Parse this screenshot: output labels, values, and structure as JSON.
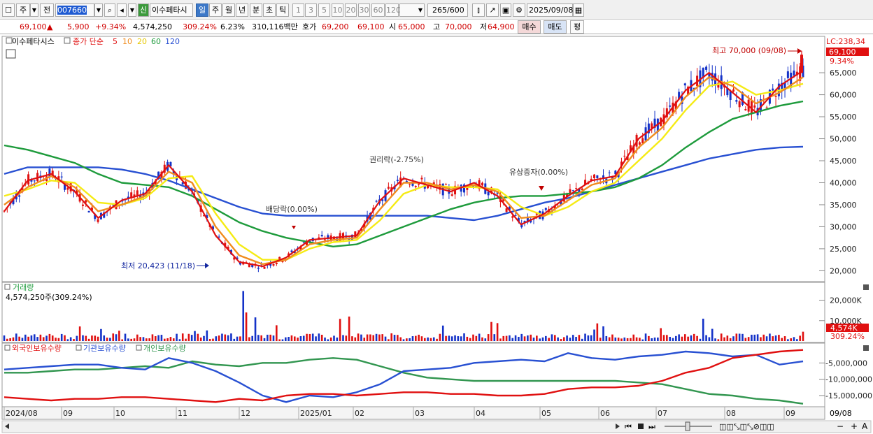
{
  "toolbar": {
    "period_type": "주",
    "prefix": "전",
    "stock_code": "007660",
    "stock_tag": "신",
    "stock_name": "이수페타시",
    "timeframes": [
      "일",
      "주",
      "월",
      "년",
      "분",
      "초",
      "틱"
    ],
    "active_timeframe": "일",
    "intervals": [
      "1",
      "3",
      "5",
      "10",
      "20",
      "30",
      "60",
      "120"
    ],
    "bar_count": "265",
    "bar_total": "/600",
    "date": "2025/09/08"
  },
  "quote": {
    "price": "69,100",
    "change_arrow": "▲",
    "change": "5,900",
    "change_pct": "+9.34%",
    "volume": "4,574,250",
    "volume_ratio": "309.24%",
    "turnover": "6.23%",
    "amount": "310,116백만",
    "ask_label": "호가",
    "ask": "69,200",
    "bid": "69,100",
    "open_label": "시",
    "open": "65,000",
    "high_label": "고",
    "high": "70,000",
    "low_label": "저",
    "low": "64,900",
    "buy_label": "매수",
    "sell_label": "매도",
    "extra_label": "평"
  },
  "price_panel": {
    "stock_name": "이수페타시스",
    "ma_label": "종가 단순",
    "ma_periods": [
      "5",
      "10",
      "20",
      "60",
      "120"
    ],
    "lc_label": "LC:238,34",
    "last_price_tag": "69,100",
    "last_pct_tag": "9.34%",
    "high_annotation": "최고 70,000 (09/08)",
    "low_annotation": "최저 20,423 (11/18)",
    "events": [
      {
        "label": "배당락(0.00%)"
      },
      {
        "label": "권리락(-2.75%)"
      },
      {
        "label": "유상증자(0.00%)"
      }
    ]
  },
  "volume_panel": {
    "title": "거래량",
    "value": "4,574,250주(309.24%)",
    "last_tag": "4,574K",
    "last_pct_tag": "309.24%"
  },
  "flow_panel": {
    "legends": [
      "외국인보유수량",
      "기관보유수량",
      "개인보유수량"
    ]
  },
  "date_axis": {
    "labels": [
      "2024/08",
      "09",
      "10",
      "11",
      "12",
      "2025/01",
      "02",
      "03",
      "04",
      "05",
      "06",
      "07",
      "08",
      "09"
    ],
    "right_label": "09/08"
  },
  "colors": {
    "ma5": "#e01010",
    "ma10": "#f08c1e",
    "ma20": "#f5eb14",
    "ma60": "#1e9b3c",
    "ma120": "#2850d2",
    "up": "#e01010",
    "down": "#1432c8",
    "foreign": "#e01010",
    "institution": "#2850d2",
    "individual": "#329650"
  },
  "chart_data": [
    {
      "type": "candlestick",
      "title": "이수페타시스",
      "y_ticks": [
        20000,
        25000,
        30000,
        35000,
        40000,
        45000,
        50000,
        55000,
        60000,
        65000
      ],
      "ylim": [
        18000,
        72000
      ],
      "x_categories": [
        "2024/08",
        "09",
        "10",
        "11",
        "12",
        "2025/01",
        "02",
        "03",
        "04",
        "05",
        "06",
        "07",
        "08",
        "09"
      ],
      "high": 70000,
      "low": 20423,
      "last": 69100,
      "ma": {
        "ma5": [
          33500,
          40500,
          42000,
          38000,
          32000,
          36000,
          37500,
          44000,
          38000,
          28000,
          22000,
          21000,
          23000,
          27000,
          27500,
          28000,
          36000,
          41000,
          39500,
          38000,
          40000,
          37000,
          30500,
          33000,
          37000,
          40500,
          41500,
          50000,
          54000,
          61000,
          65000,
          60500,
          56000,
          62000,
          65500
        ],
        "ma10": [
          35000,
          39000,
          41500,
          39000,
          33500,
          35000,
          37000,
          42500,
          40000,
          30000,
          23500,
          21500,
          22500,
          26000,
          27000,
          27500,
          34000,
          40000,
          40000,
          38500,
          39500,
          38000,
          32000,
          32500,
          36000,
          39500,
          41000,
          48000,
          52500,
          59500,
          64000,
          62000,
          58000,
          60500,
          64000
        ],
        "ma20": [
          37000,
          38500,
          40500,
          40000,
          35500,
          35000,
          36500,
          41000,
          41500,
          33000,
          26000,
          22500,
          22500,
          25000,
          26500,
          27000,
          31500,
          37500,
          39500,
          39000,
          39000,
          38500,
          34500,
          32500,
          34500,
          38000,
          40000,
          45000,
          50000,
          56500,
          62000,
          63000,
          60000,
          61000,
          62500
        ],
        "ma60": [
          48500,
          47500,
          46000,
          44500,
          42000,
          40000,
          39500,
          39000,
          37000,
          34000,
          31000,
          29000,
          27500,
          26500,
          25500,
          26000,
          28000,
          30000,
          32000,
          34000,
          35500,
          36500,
          37000,
          37000,
          37500,
          38000,
          39000,
          41000,
          44000,
          48000,
          51500,
          54500,
          56000,
          57500,
          58500
        ],
        "ma120": [
          42000,
          43500,
          43500,
          43500,
          43500,
          43000,
          42000,
          40500,
          38500,
          36500,
          34500,
          33000,
          32500,
          32500,
          32500,
          32500,
          32500,
          32500,
          32500,
          32000,
          31500,
          32500,
          34000,
          35500,
          36500,
          38000,
          39500,
          41000,
          42500,
          44000,
          45500,
          46500,
          47500,
          48000,
          48200
        ]
      }
    },
    {
      "type": "bar",
      "title": "거래량",
      "y_ticks": [
        10000,
        20000
      ],
      "yunit": "K",
      "ylim": [
        0,
        26000
      ],
      "last": 4574
    },
    {
      "type": "line",
      "y_ticks": [
        -5000000,
        -10000000,
        -15000000
      ],
      "ylim": [
        -18000000,
        0
      ],
      "series": [
        {
          "name": "외국인보유수량",
          "values": [
            -15500000,
            -16000000,
            -16500000,
            -16000000,
            -16000000,
            -15500000,
            -15500000,
            -16000000,
            -16500000,
            -17000000,
            -16000000,
            -16500000,
            -15000000,
            -14500000,
            -14500000,
            -15000000,
            -14500000,
            -14000000,
            -14000000,
            -14500000,
            -14500000,
            -15000000,
            -15000000,
            -14500000,
            -13000000,
            -12500000,
            -12500000,
            -12000000,
            -10500000,
            -8000000,
            -6500000,
            -3500000,
            -2500000,
            -1500000,
            -1000000
          ]
        },
        {
          "name": "기관보유수량",
          "values": [
            -7000000,
            -6500000,
            -6000000,
            -5500000,
            -5500000,
            -6500000,
            -7000000,
            -3500000,
            -5000000,
            -7500000,
            -11000000,
            -15000000,
            -17000000,
            -15000000,
            -15500000,
            -14000000,
            -11500000,
            -7500000,
            -7000000,
            -6500000,
            -5000000,
            -4500000,
            -4000000,
            -4500000,
            -2000000,
            -3500000,
            -4000000,
            -3000000,
            -2500000,
            -1500000,
            -2000000,
            -3000000,
            -2500000,
            -5500000,
            -4500000
          ]
        },
        {
          "name": "개인보유수량",
          "values": [
            -8000000,
            -8000000,
            -7500000,
            -7000000,
            -7000000,
            -6500000,
            -6000000,
            -6500000,
            -4500000,
            -5500000,
            -6000000,
            -5000000,
            -5000000,
            -4000000,
            -3500000,
            -4000000,
            -6000000,
            -8000000,
            -9500000,
            -10000000,
            -10500000,
            -10500000,
            -10500000,
            -10500000,
            -10500000,
            -10500000,
            -10500000,
            -11000000,
            -11500000,
            -13000000,
            -14500000,
            -15000000,
            -16000000,
            -16500000,
            -17500000
          ]
        }
      ]
    }
  ]
}
